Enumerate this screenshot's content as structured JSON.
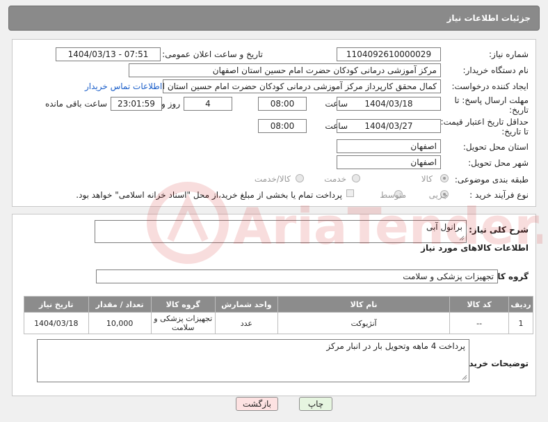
{
  "header": {
    "title": "جزئیات اطلاعات نیاز"
  },
  "form": {
    "need_number_label": "شماره نیاز:",
    "need_number": "1104092610000029",
    "announce_label": "تاریخ و ساعت اعلان عمومی:",
    "announce_value": "1404/03/13 - 07:51",
    "buyer_label": "نام دستگاه خریدار:",
    "buyer_value": "مرکز آموزشی درمانی کودکان حضرت امام حسین استان اصفهان",
    "creator_label": "ایجاد کننده درخواست:",
    "creator_value": "کمال محقق کارپرداز مرکز آموزشی درمانی کودکان حضرت امام حسین استان اص",
    "contact_link": "اطلاعات تماس خریدار",
    "deadline_label_1": "مهلت ارسال پاسخ: تا",
    "deadline_label_2": "تاریخ:",
    "deadline_date": "1404/03/18",
    "time_label": "ساعت",
    "deadline_time": "08:00",
    "days_value": "4",
    "days_label": "روز و",
    "remaining_time": "23:01:59",
    "remaining_label": "ساعت باقی مانده",
    "price_label_1": "حداقل تاریخ اعتبار قیمت:",
    "price_label_2": "تا تاریخ:",
    "price_date": "1404/03/27",
    "price_time": "08:00",
    "province_label": "استان محل تحویل:",
    "province_value": "اصفهان",
    "city_label": "شهر محل تحویل:",
    "city_value": "اصفهان",
    "category_label": "طبقه بندی موضوعی:",
    "category_options": [
      "کالا",
      "خدمت",
      "کالا/خدمت"
    ],
    "category_selected": "کالا",
    "process_label": "نوع فرآیند خرید :",
    "process_options": [
      "جزیی",
      "متوسط"
    ],
    "process_selected": "جزیی",
    "payment_note": "پرداخت تمام یا بخشی از مبلغ خرید،از محل \"اسناد خزانه اسلامی\" خواهد بود."
  },
  "description": {
    "label": "شرح کلی نیاز:",
    "value": "برانول آبی"
  },
  "goods": {
    "section_title": "اطلاعات کالاهای مورد نیاز",
    "group_label": "گروه کالا:",
    "group_value": "تجهیزات پزشکی و سلامت",
    "columns": [
      "ردیف",
      "کد کالا",
      "نام کالا",
      "واحد شمارش",
      "گروه کالا",
      "تعداد / مقدار",
      "تاریخ نیاز"
    ],
    "rows": [
      {
        "row": "1",
        "code": "--",
        "name": "آنژیوکت",
        "unit": "عدد",
        "group": "تجهیزات پزشکی و سلامت",
        "qty": "10,000",
        "date": "1404/03/18"
      }
    ]
  },
  "buyer_notes": {
    "label": "توضیحات خریدار:",
    "value": "پرداخت 4 ماهه وتحویل بار در انبار مرکز"
  },
  "buttons": {
    "print": "چاپ",
    "back": "بازگشت"
  },
  "watermark": {
    "text": "AriaTender.neT"
  },
  "colors": {
    "header_bg": "#8a8a8a",
    "link": "#1a5ec9",
    "back_button_bg": "#fde2e2",
    "print_button_bg": "#e6f5e0"
  }
}
